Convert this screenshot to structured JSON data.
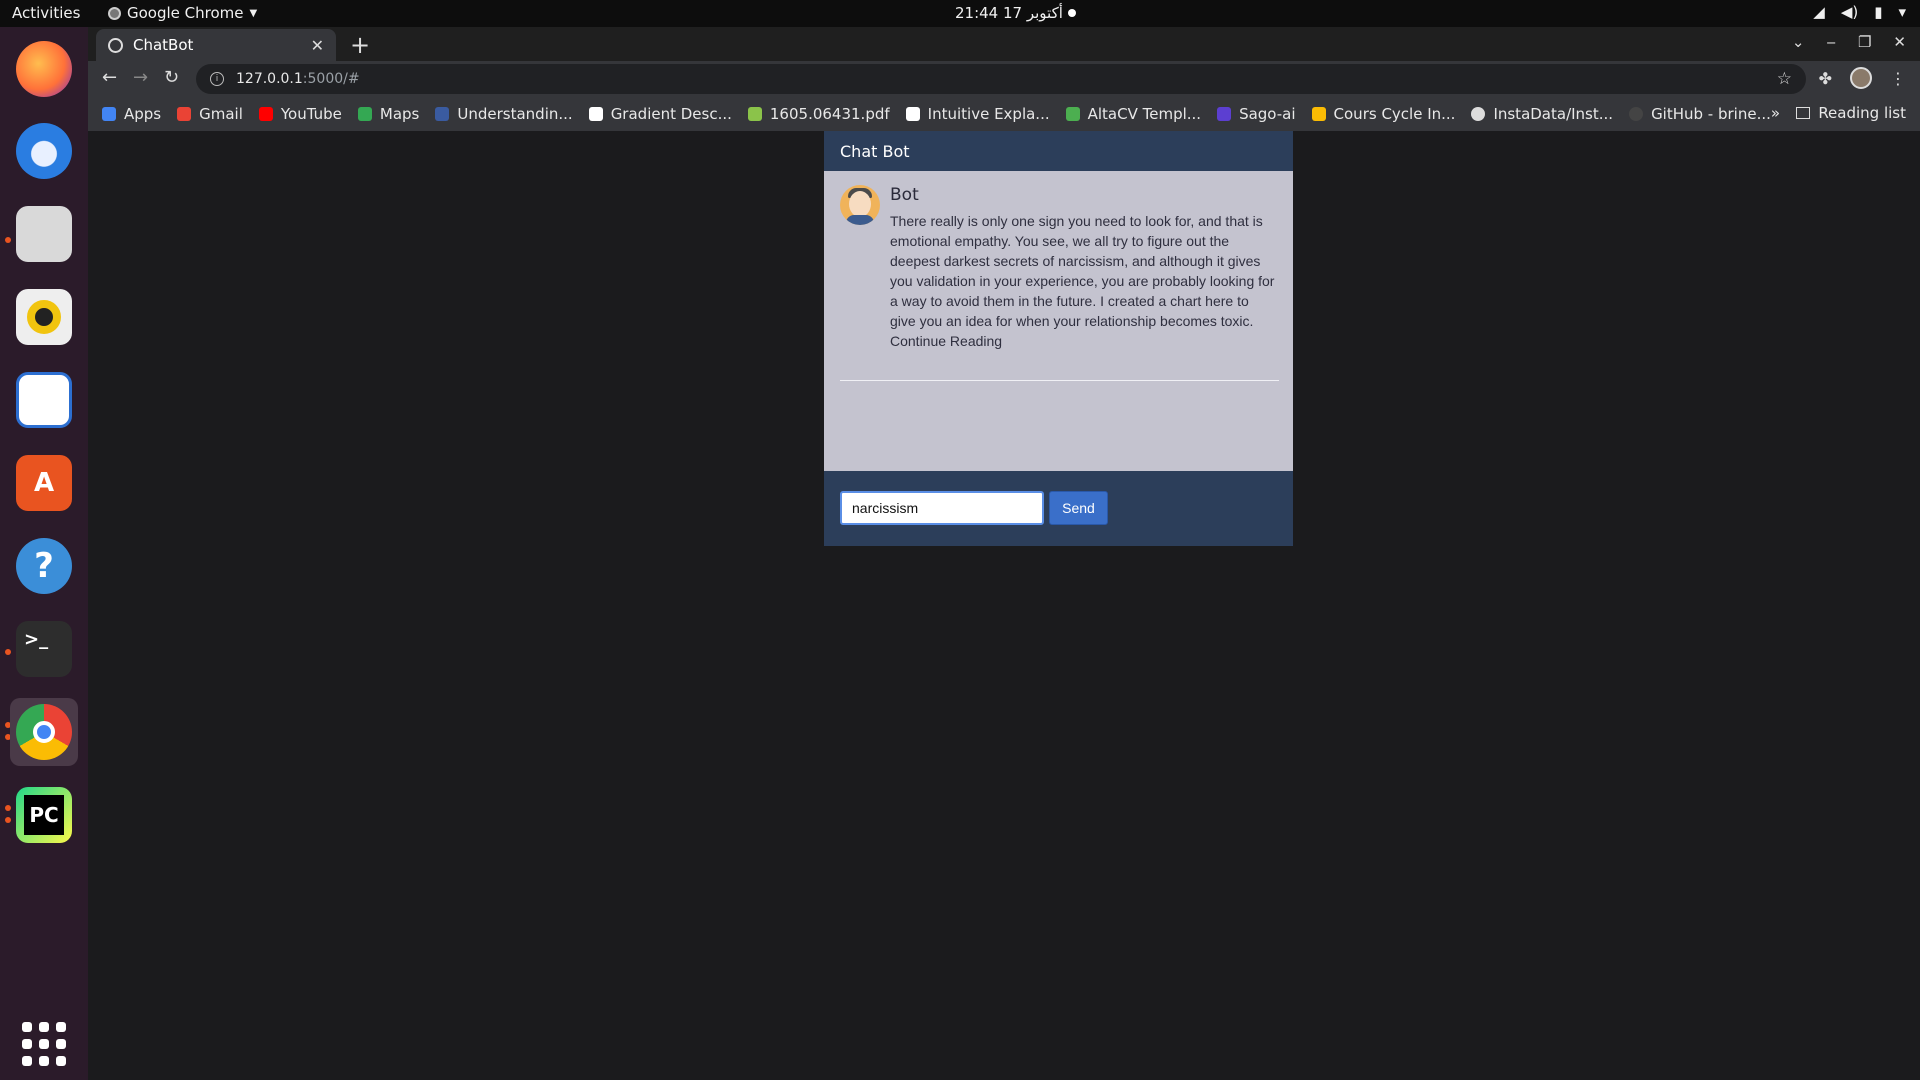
{
  "os_topbar": {
    "activities": "Activities",
    "app_name": "Google Chrome",
    "clock": "21:44  17 أكتوبر"
  },
  "dock": {
    "items": [
      {
        "name": "Firefox",
        "icon": "firefox-icon",
        "color": "#ff7139"
      },
      {
        "name": "Thunderbird",
        "icon": "thunderbird-icon",
        "color": "#2a7de1"
      },
      {
        "name": "Files",
        "icon": "files-icon",
        "color": "#d9d9d9"
      },
      {
        "name": "Rhythmbox",
        "icon": "rhythmbox-icon",
        "color": "#f1c40f"
      },
      {
        "name": "LibreOffice Writer",
        "icon": "writer-icon",
        "color": "#2c6fd1"
      },
      {
        "name": "Ubuntu Software",
        "icon": "software-icon",
        "color": "#e95420"
      },
      {
        "name": "Help",
        "icon": "help-icon",
        "color": "#3b8ed8"
      },
      {
        "name": "Terminal",
        "icon": "terminal-icon",
        "color": "#2d2d2d"
      },
      {
        "name": "Google Chrome",
        "icon": "chrome-icon",
        "color": "#4285f4"
      },
      {
        "name": "PyCharm",
        "icon": "pycharm-icon",
        "color": "#21d789"
      }
    ],
    "help_glyph": "?",
    "terminal_glyph": ">_",
    "pycharm_glyph": "PC",
    "software_glyph": "A"
  },
  "browser": {
    "tab_title": "ChatBot",
    "tab_close": "✕",
    "new_tab": "+",
    "url_host": "127.0.0.1",
    "url_rest": ":5000/#",
    "bookmarks": [
      {
        "label": "Apps",
        "color": "#4285f4"
      },
      {
        "label": "Gmail",
        "color": "#ea4335"
      },
      {
        "label": "YouTube",
        "color": "#ff0000"
      },
      {
        "label": "Maps",
        "color": "#34a853"
      },
      {
        "label": "Understandin...",
        "color": "#3a5ba0"
      },
      {
        "label": "Gradient Desc...",
        "color": "#ffffff"
      },
      {
        "label": "1605.06431.pdf",
        "color": "#8bc34a"
      },
      {
        "label": "Intuitive Expla...",
        "color": "#ffffff"
      },
      {
        "label": "AltaCV Templ...",
        "color": "#4caf50"
      },
      {
        "label": "Sago-ai",
        "color": "#5c3fd1"
      },
      {
        "label": "Cours Cycle In...",
        "color": "#fbbc04"
      },
      {
        "label": "InstaData/Inst...",
        "color": "#dddddd"
      },
      {
        "label": "GitHub - brine...",
        "color": "#444444"
      }
    ],
    "more": "»",
    "reading_list": "Reading list"
  },
  "chat": {
    "header": "Chat Bot",
    "sender": "Bot",
    "message": "There really is only one sign you need to look for, and that is emotional empathy. You see, we all try to figure out the deepest darkest secrets of narcissism, and although it gives you validation in your experience, you are probably looking for a way to avoid them in the future. I created a chart here to give you an idea for when your relationship becomes toxic.",
    "link": "Continue Reading",
    "input_value": "narcissism",
    "send_label": "Send"
  }
}
